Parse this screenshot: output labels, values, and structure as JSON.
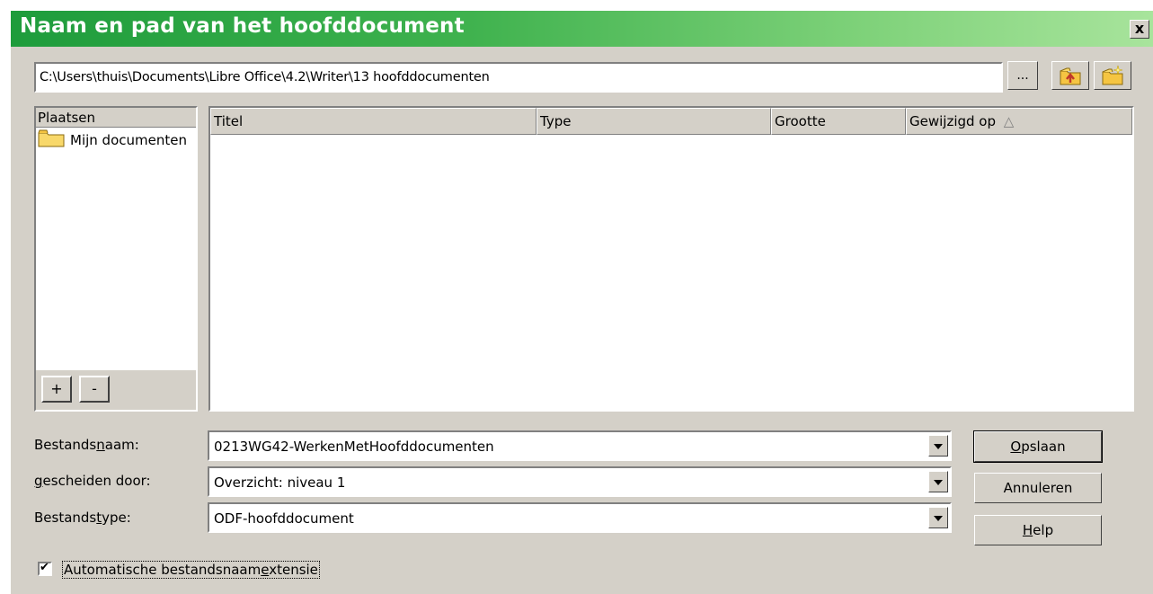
{
  "window": {
    "title": "Naam en pad van het hoofddocument",
    "close_label": "x"
  },
  "path": {
    "value": "C:\\Users\\thuis\\Documents\\Libre Office\\4.2\\Writer\\13 hoofddocumenten",
    "browse_label": "..."
  },
  "places": {
    "header": "Plaatsen",
    "items": [
      {
        "label": "Mijn documenten"
      }
    ],
    "add_label": "+",
    "remove_label": "-"
  },
  "file_list": {
    "columns": [
      "Titel",
      "Type",
      "Grootte",
      "Gewijzigd op"
    ],
    "sort_indicator": "△",
    "rows": []
  },
  "form": {
    "filename": {
      "label_pre": "Bestands",
      "label_u": "n",
      "label_post": "aam:",
      "value": "0213WG42-WerkenMetHoofddocumenten"
    },
    "separated": {
      "label_pre": "",
      "label_u": "g",
      "label_post": "escheiden door:",
      "value": "Overzicht: niveau 1"
    },
    "filetype": {
      "label_pre": "Bestands",
      "label_u": "t",
      "label_post": "ype:",
      "value": "ODF-hoofddocument"
    }
  },
  "buttons": {
    "save": {
      "u": "O",
      "rest": "pslaan"
    },
    "cancel": {
      "label": "Annuleren"
    },
    "help": {
      "u": "H",
      "rest": "elp"
    }
  },
  "auto_ext": {
    "checked": true,
    "checkmark": "✔",
    "label_pre": "Automatische bestandsnaam",
    "label_u": "e",
    "label_post": "xtensie"
  }
}
